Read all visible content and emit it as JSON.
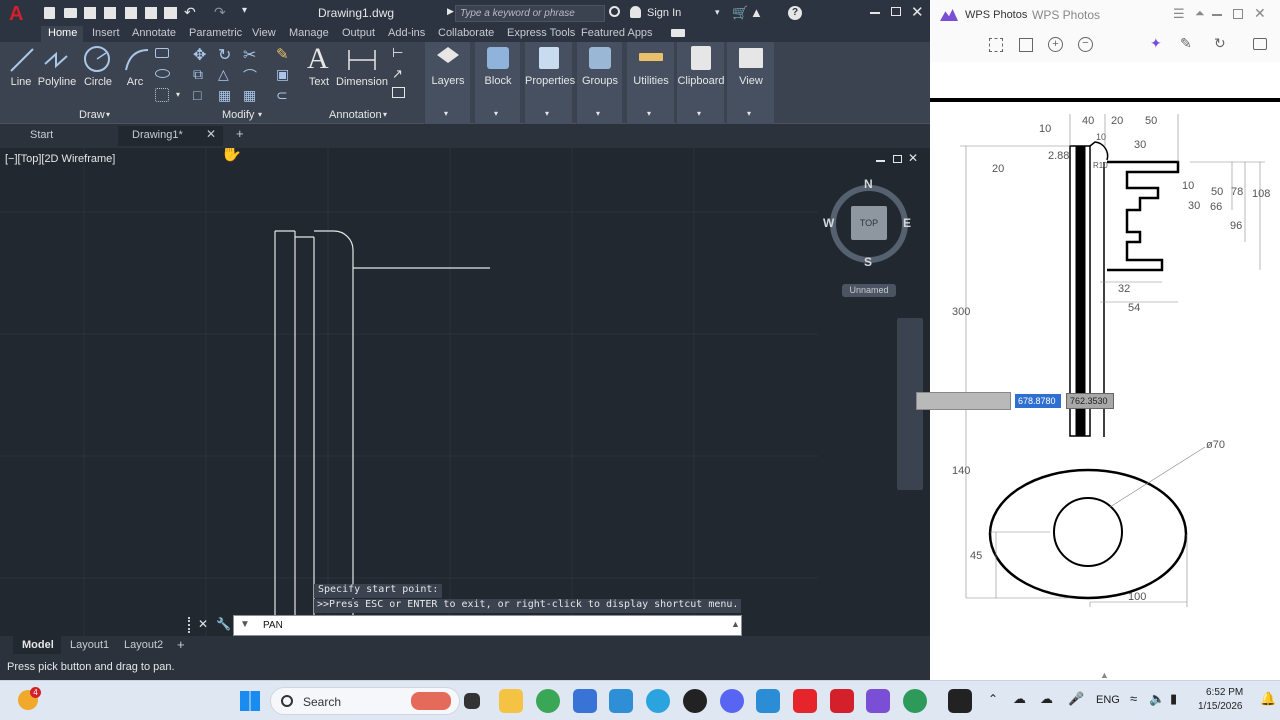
{
  "acad": {
    "title": "Drawing1.dwg",
    "search_placeholder": "Type a keyword or phrase",
    "sign_in": "Sign In",
    "menu_tabs": [
      "Home",
      "Insert",
      "Annotate",
      "Parametric",
      "View",
      "Manage",
      "Output",
      "Add-ins",
      "Collaborate",
      "Express Tools",
      "Featured Apps"
    ],
    "draw_tools": [
      "Line",
      "Polyline",
      "Circle",
      "Arc"
    ],
    "panels": {
      "draw": "Draw",
      "modify": "Modify",
      "annotation": "Annotation"
    },
    "annotation_tools": [
      "Text",
      "Dimension"
    ],
    "big_buttons": [
      "Layers",
      "Block",
      "Properties",
      "Groups",
      "Utilities",
      "Clipboard",
      "View"
    ],
    "file_tabs": {
      "start": "Start",
      "drawing": "Drawing1*"
    },
    "viewport_label": "[−][Top][2D Wireframe]",
    "viewcube": {
      "n": "N",
      "s": "S",
      "e": "E",
      "w": "W",
      "face": "TOP",
      "ucs": "Unnamed"
    },
    "command_history": [
      "Specify start point:",
      ">>Press ESC or ENTER to exit, or right-click to display shortcut menu."
    ],
    "command_input": "PAN",
    "layout_tabs": [
      "Model",
      "Layout1",
      "Layout2"
    ],
    "status_text": "Press pick button and drag to pan."
  },
  "wps": {
    "logo_text": "WPS Photos",
    "tab_text": "WPS Photos",
    "coord_x": "678.8780",
    "coord_y": "762.3530",
    "dims": [
      "10",
      "40",
      "20",
      "50",
      "10",
      "2.88",
      "30",
      "20",
      "10",
      "50",
      "78",
      "108",
      "30",
      "66",
      "96",
      "300",
      "32",
      "54",
      "ø70",
      "140",
      "45",
      "100",
      "R10"
    ]
  },
  "taskbar": {
    "search": "Search",
    "lang": "ENG",
    "time": "6:52 PM",
    "date": "1/15/2026",
    "badge": "4"
  },
  "colors": {
    "accent_red": "#d3202a",
    "viewport": "#212830",
    "ribbon": "#3b4350"
  }
}
